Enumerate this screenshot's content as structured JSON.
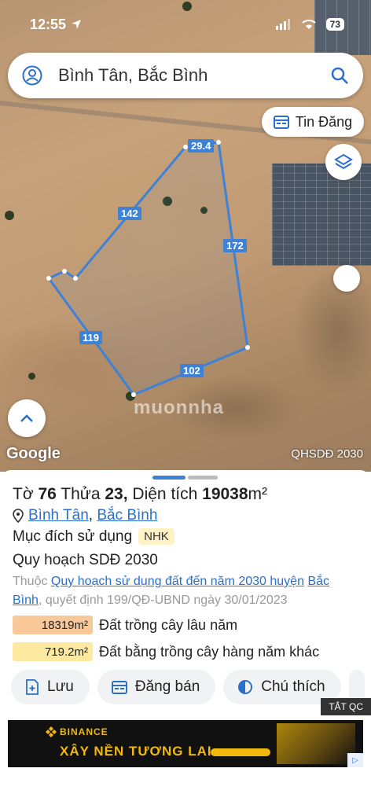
{
  "status_bar": {
    "time": "12:55",
    "battery": "73"
  },
  "search": {
    "value": "Bình Tân, Bắc Bình"
  },
  "map": {
    "tin_dang_label": "Tin Đăng",
    "edge_labels": [
      "29.4",
      "142",
      "172",
      "119",
      "102"
    ],
    "google_label": "Google",
    "layer_label": "QHSDĐ 2030",
    "watermark": "muonnha"
  },
  "parcel": {
    "to_label": "Tờ",
    "to_value": "76",
    "thua_label": "Thửa",
    "thua_value": "23,",
    "dien_tich_label": "Diện tích",
    "dien_tich_value": "19038",
    "unit": "m²",
    "location_1": "Bình Tân",
    "location_sep": ",",
    "location_2": "Bắc Bình",
    "purpose_label": "Mục đích sử dụng",
    "purpose_code": "NHK",
    "plan_label": "Quy hoạch SDĐ 2030",
    "note_prefix": "Thuộc",
    "note_link_1": "Quy hoạch sử dụng đất đến năm 2030 huyện",
    "note_link_2": "Bắc Bình",
    "note_suffix": ", quyết định 199/QĐ-UBND ngày 30/01/2023",
    "areas": [
      {
        "value": "18319m²",
        "label": "Đất trồng cây lâu năm",
        "color": "#f8c898"
      },
      {
        "value": "719.2m²",
        "label": "Đất bằng trồng cây hàng năm khác",
        "color": "#fdeaa0"
      }
    ]
  },
  "actions": {
    "save": "Lưu",
    "post_sale": "Đăng bán",
    "legend": "Chú thích"
  },
  "ads": {
    "close_label": "TẮT QC",
    "brand": "BINANCE",
    "slogan": "XÂY NỀN TƯƠNG LAI"
  },
  "colors": {
    "accent": "#3d82d6",
    "link": "#2a6fc9"
  }
}
